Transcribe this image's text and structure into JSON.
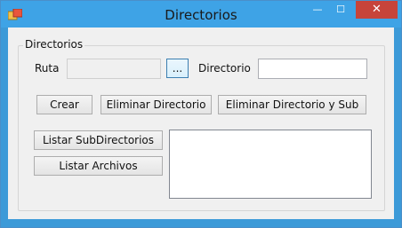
{
  "window": {
    "title": "Directorios",
    "controls": {
      "minimize": "—",
      "maximize": "☐",
      "close": "✕"
    }
  },
  "group": {
    "label": "Directorios"
  },
  "form": {
    "ruta_label": "Ruta",
    "ruta_value": "",
    "browse_label": "...",
    "directorio_label": "Directorio",
    "directorio_value": ""
  },
  "buttons": {
    "crear": "Crear",
    "eliminar": "Eliminar Directorio",
    "eliminar_sub": "Eliminar Directorio y Sub",
    "listar_sub": "Listar SubDirectorios",
    "listar_archivos": "Listar Archivos"
  },
  "results": {
    "items": []
  },
  "colors": {
    "titlebar": "#3ea3e6",
    "close": "#c7443a",
    "client": "#f0f0f0"
  }
}
